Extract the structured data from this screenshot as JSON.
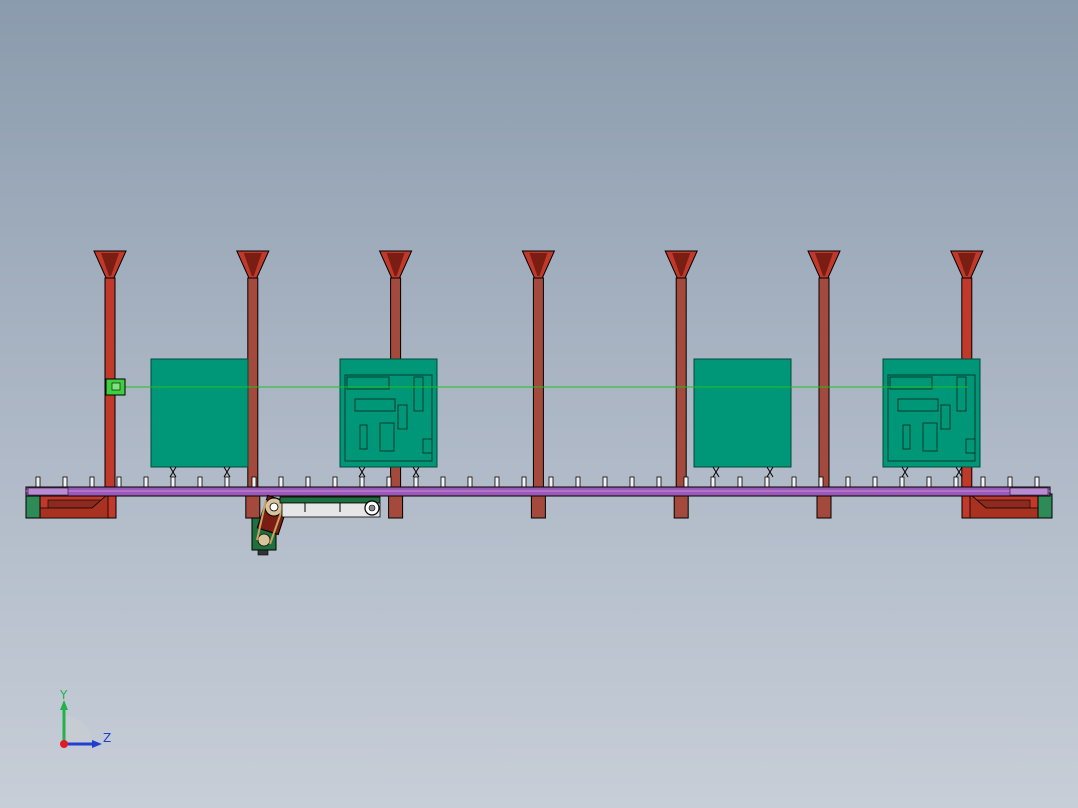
{
  "viewport": {
    "background_top": "#8a9bad",
    "background_bottom": "#c7ced8"
  },
  "model": {
    "frame_color": "#c0392b",
    "frame_dark": "#7a1d12",
    "frame_shade": "#a44a3c",
    "rail_color": "#9b59b6",
    "panel_color": "#009678",
    "panel_border": "#004a3a",
    "motor_color": "#1f6f3f",
    "sensor_color": "#3ecf3e",
    "beam_color": "#22c022",
    "post_count": 7,
    "panels": [
      {
        "id": "panel-1",
        "has_circuit": false
      },
      {
        "id": "panel-2",
        "has_circuit": true
      },
      {
        "id": "panel-3",
        "has_circuit": false
      },
      {
        "id": "panel-4",
        "has_circuit": true
      }
    ]
  },
  "triad": {
    "y_label": "Y",
    "z_label": "Z",
    "y_color": "#22b14c",
    "z_color": "#1f3fd0",
    "x_color": "#e01b24"
  }
}
